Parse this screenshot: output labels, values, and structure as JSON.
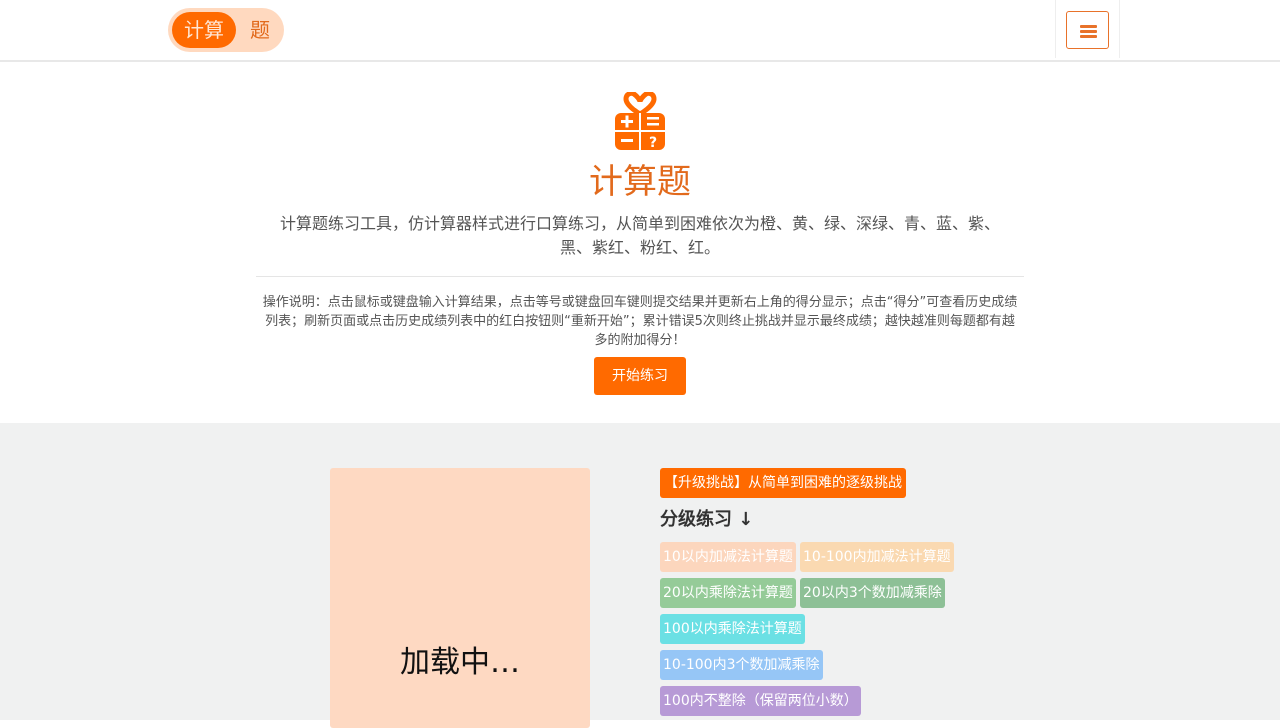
{
  "header": {
    "logo_left": "计算",
    "logo_right": "题"
  },
  "hero": {
    "title": "计算题",
    "description": "计算题练习工具，仿计算器样式进行口算练习，从简单到困难依次为橙、黄、绿、深绿、青、蓝、紫、黑、紫红、粉红、红。",
    "help": "操作说明：点击鼠标或键盘输入计算结果，点击等号或键盘回车键则提交结果并更新右上角的得分显示；点击“得分”可查看历史成绩列表；刷新页面或点击历史成绩列表中的红白按钮则“重新开始”；累计错误5次则终止挑战并显示最终成绩；越快越准则每题都有越多的附加得分！",
    "start_label": "开始练习"
  },
  "calculator": {
    "loading": "加载中…"
  },
  "levels": {
    "challenge_label": "【升级挑战】从简单到困难的逐级挑战",
    "heading": "分级练习 ↓",
    "items": [
      {
        "label": "10以内加减法计算题",
        "color": "#fcd6bd"
      },
      {
        "label": "10-100内加减法计算题",
        "color": "#fad9b1"
      },
      {
        "label": "20以内乘除法计算题",
        "color": "#95cb98"
      },
      {
        "label": "20以内3个数加减乘除",
        "color": "#8dc096"
      },
      {
        "label": "100以内乘除法计算题",
        "color": "#6be0e4"
      },
      {
        "label": "10-100内3个数加减乘除",
        "color": "#96c6f6"
      },
      {
        "label": "100内不整除（保留两位小数）",
        "color": "#b79ad6"
      }
    ]
  },
  "colors": {
    "accent": "#ff6a00",
    "accent_text": "#e26a1c",
    "lower_bg": "#f0f1f1",
    "calc_bg": "#fed9c2"
  }
}
